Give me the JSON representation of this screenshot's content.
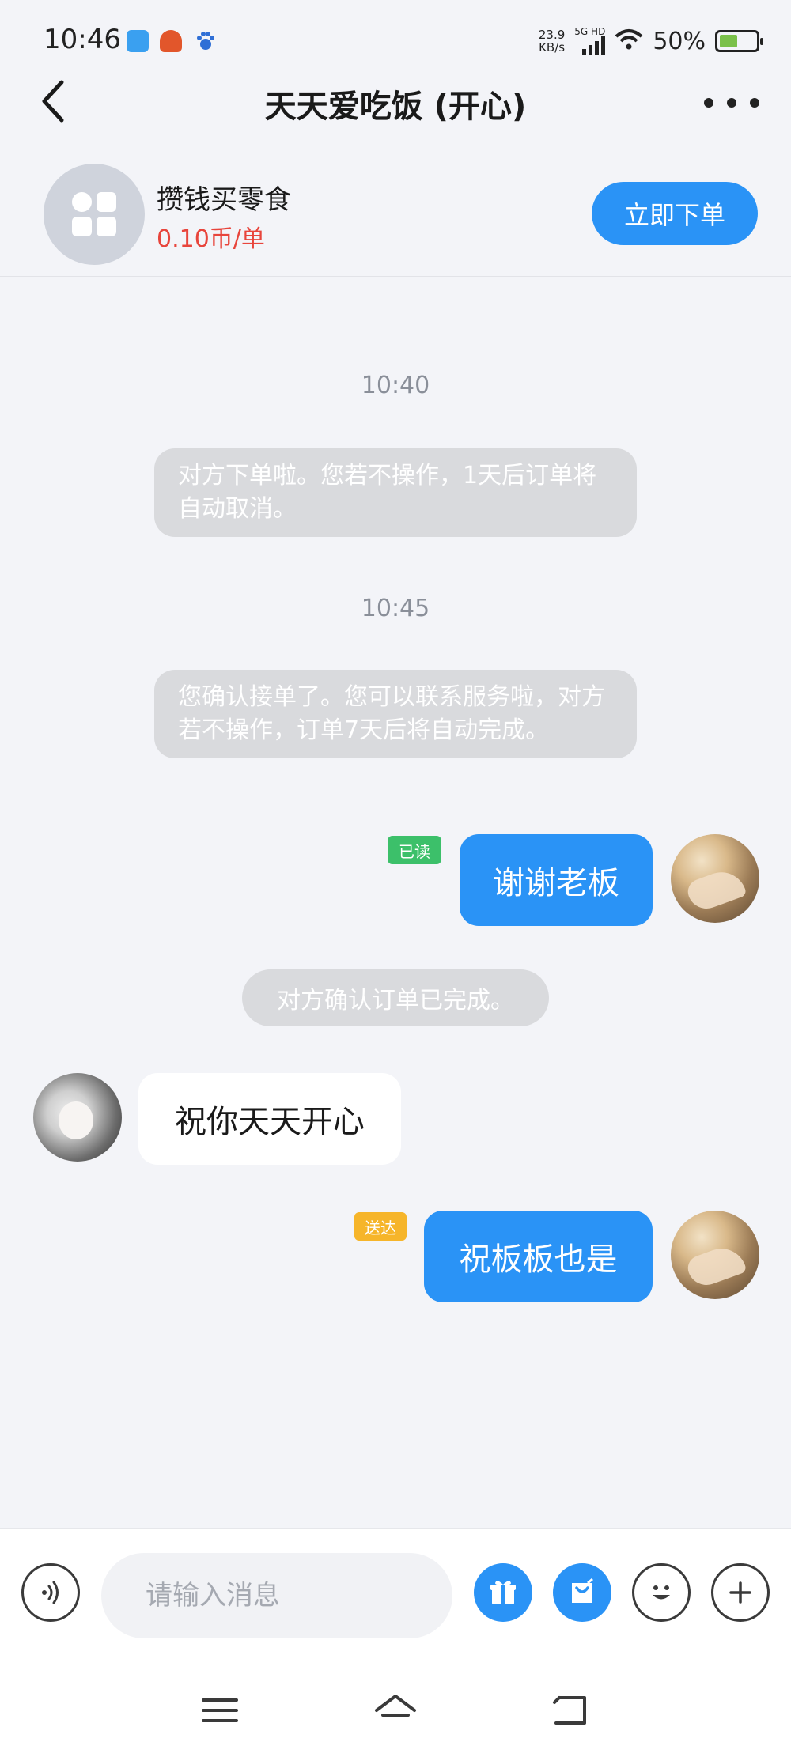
{
  "status_bar": {
    "time": "10:46",
    "net_speed_value": "23.9",
    "net_speed_unit": "KB/s",
    "network": "5G HD",
    "battery_percent": "50%",
    "battery_level": 0.5
  },
  "header": {
    "title": "天天爱吃饭 (开心)",
    "back_icon": "chevron-left-icon",
    "more_icon": "more-dots-icon"
  },
  "service": {
    "name": "攒钱买零食",
    "price": "0.10币/单",
    "order_button": "立即下单",
    "accent_color": "#2a93f6",
    "price_color": "#e8453c"
  },
  "chat": {
    "time_1": "10:40",
    "system_1": "对方下单啦。您若不操作，1天后订单将自动取消。",
    "time_2": "10:45",
    "system_2": "您确认接单了。您可以联系服务啦，对方若不操作，订单7天后将自动完成。",
    "msg_1_text": "谢谢老板",
    "msg_1_status": "已读",
    "system_3": "对方确认订单已完成。",
    "msg_2_text": "祝你天天开心",
    "msg_3_text": "祝板板也是",
    "msg_3_status": "送达"
  },
  "input_bar": {
    "placeholder": "请输入消息",
    "icons": [
      "voice-icon",
      "gift-icon",
      "bag-icon",
      "emoji-icon",
      "plus-icon"
    ]
  },
  "nav_bar": {
    "icons": [
      "menu-icon",
      "home-icon",
      "back-nav-icon"
    ]
  }
}
